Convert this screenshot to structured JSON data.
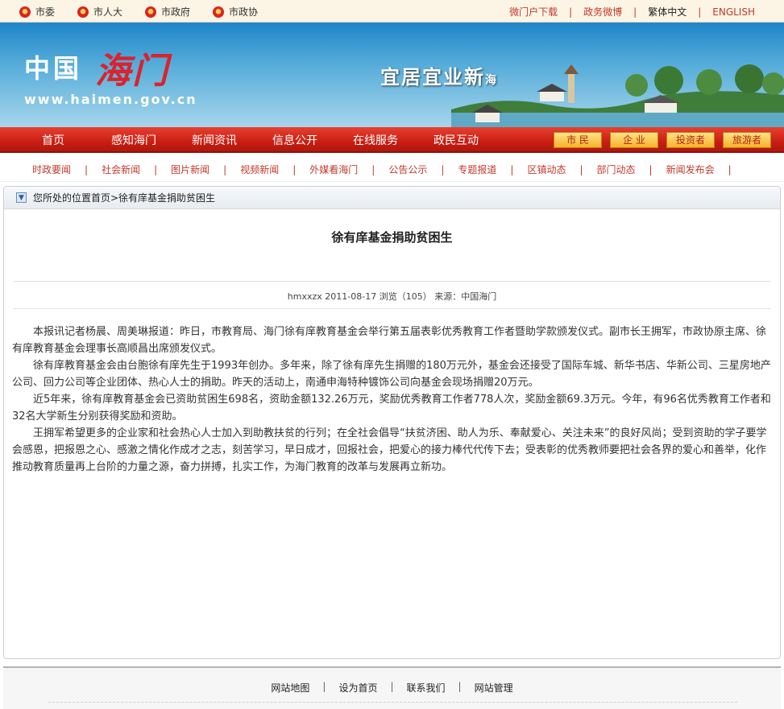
{
  "topbar": {
    "left_links": [
      {
        "label": "市委"
      },
      {
        "label": "市人大"
      },
      {
        "label": "市政府"
      },
      {
        "label": "市政协"
      }
    ],
    "right_links": [
      {
        "label": "微门户下载"
      },
      {
        "label": "政务微博"
      },
      {
        "label": "繁体中文"
      },
      {
        "label": "ENGLISH"
      }
    ]
  },
  "banner": {
    "logo_cn": "中国",
    "logo_hm": "海门",
    "url": "www.haimen.gov.cn",
    "slogan": "宜居宜业新",
    "slogan_small": "海"
  },
  "nav": {
    "items": [
      "首页",
      "感知海门",
      "新闻资讯",
      "信息公开",
      "在线服务",
      "政民互动"
    ],
    "buttons": [
      "市 民",
      "企 业",
      "投资者",
      "旅游者"
    ]
  },
  "subnav": {
    "items": [
      "时政要闻",
      "社会新闻",
      "图片新闻",
      "视频新闻",
      "外媒看海门",
      "公告公示",
      "专题报道",
      "区镇动态",
      "部门动态",
      "新闻发布会"
    ]
  },
  "breadcrumb": "您所处的位置首页>徐有庠基金捐助贫困生",
  "article": {
    "title": "徐有庠基金捐助贫困生",
    "meta": "hmxxzx  2011-08-17  浏览（105）  来源：中国海门",
    "paragraphs": [
      "本报讯记者杨晨、周美琳报道：昨日，市教育局、海门徐有庠教育基金会举行第五届表彰优秀教育工作者暨助学款颁发仪式。副市长王拥军，市政协原主席、徐有庠教育基金会理事长高顺昌出席颁发仪式。",
      "徐有庠教育基金会由台胞徐有庠先生于1993年创办。多年来，除了徐有庠先生捐赠的180万元外，基金会还接受了国际车城、新华书店、华新公司、三星房地产公司、回力公司等企业团体、热心人士的捐助。昨天的活动上，南通申海特种镀饰公司向基金会现场捐赠20万元。",
      "近5年来，徐有庠教育基金会已资助贫困生698名，资助金额132.26万元，奖励优秀教育工作者778人次，奖励金额69.3万元。今年，有96名优秀教育工作者和32名大学新生分别获得奖励和资助。",
      "王拥军希望更多的企业家和社会热心人士加入到助教扶贫的行列；在全社会倡导“扶贫济困、助人为乐、奉献爱心、关注未来”的良好风尚；受到资助的学子要学会感恩，把报恩之心、感激之情化作成才之志，刻苦学习，早日成才，回报社会，把爱心的接力棒代代传下去；受表彰的优秀教师要把社会各界的爱心和善举，化作推动教育质量再上台阶的力量之源，奋力拼搏，扎实工作，为海门教育的改革与发展再立新功。"
    ]
  },
  "footer": {
    "links": [
      "网站地图",
      "设为首页",
      "联系我们",
      "网站管理"
    ]
  },
  "colors": {
    "nav_red": "#c81f13",
    "link_red": "#c0392b",
    "button_gold": "#f6b32a"
  }
}
